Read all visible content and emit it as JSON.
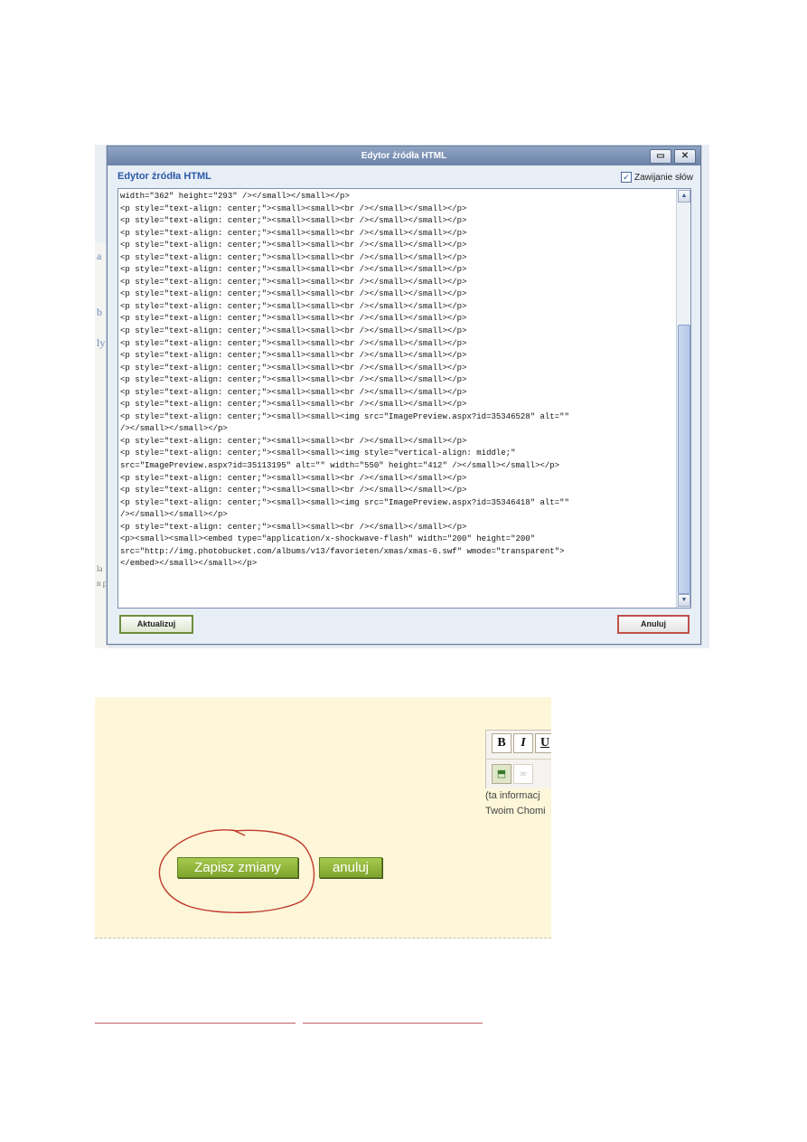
{
  "dialog": {
    "title": "Edytor źródła HTML",
    "heading": "Edytor źródła HTML",
    "wrap_label": "Zawijanie słów",
    "wrap_checked": true,
    "min_glyph": "▭",
    "close_glyph": "✕",
    "update_label": "Aktualizuj",
    "cancel_label": "Anuluj",
    "code_lines": [
      "width=\"362\" height=\"293\" /></small></small></p>",
      "<p style=\"text-align: center;\"><small><small><br /></small></small></p>",
      "<p style=\"text-align: center;\"><small><small><br /></small></small></p>",
      "<p style=\"text-align: center;\"><small><small><br /></small></small></p>",
      "<p style=\"text-align: center;\"><small><small><br /></small></small></p>",
      "<p style=\"text-align: center;\"><small><small><br /></small></small></p>",
      "<p style=\"text-align: center;\"><small><small><br /></small></small></p>",
      "<p style=\"text-align: center;\"><small><small><br /></small></small></p>",
      "<p style=\"text-align: center;\"><small><small><br /></small></small></p>",
      "<p style=\"text-align: center;\"><small><small><br /></small></small></p>",
      "<p style=\"text-align: center;\"><small><small><br /></small></small></p>",
      "<p style=\"text-align: center;\"><small><small><br /></small></small></p>",
      "<p style=\"text-align: center;\"><small><small><br /></small></small></p>",
      "<p style=\"text-align: center;\"><small><small><br /></small></small></p>",
      "<p style=\"text-align: center;\"><small><small><br /></small></small></p>",
      "<p style=\"text-align: center;\"><small><small><br /></small></small></p>",
      "<p style=\"text-align: center;\"><small><small><br /></small></small></p>",
      "<p style=\"text-align: center;\"><small><small><br /></small></small></p>",
      "<p style=\"text-align: center;\"><small><small><img src=\"ImagePreview.aspx?id=35346528\" alt=\"\"",
      "/></small></small></p>",
      "<p style=\"text-align: center;\"><small><small><br /></small></small></p>",
      "<p style=\"text-align: center;\"><small><small><img style=\"vertical-align: middle;\"",
      "src=\"ImagePreview.aspx?id=35113195\" alt=\"\" width=\"550\" height=\"412\" /></small></small></p>",
      "<p style=\"text-align: center;\"><small><small><br /></small></small></p>",
      "<p style=\"text-align: center;\"><small><small><br /></small></small></p>",
      "<p style=\"text-align: center;\"><small><small><img src=\"ImagePreview.aspx?id=35346418\" alt=\"\"",
      "/></small></small></p>",
      "<p style=\"text-align: center;\"><small><small><br /></small></small></p>",
      "<p><small><small><embed type=\"application/x-shockwave-flash\" width=\"200\" height=\"200\"",
      "src=\"http://img.photobucket.com/albums/v13/favorieten/xmas/xmas-6.swf\" wmode=\"transparent\">",
      "</embed></small></small></p>"
    ]
  },
  "editor_panel": {
    "bold": "B",
    "italic": "I",
    "underline": "U",
    "info_line1": "(ta informacj",
    "info_line2": "Twoim Chomi",
    "save_label": "Zapisz zmiany",
    "cancel_label": "anuluj",
    "accent_color": "#8ab43a",
    "annotation_color": "#c0392b"
  },
  "background_strip": [
    "a",
    "b",
    "ly",
    "la",
    "n p"
  ]
}
